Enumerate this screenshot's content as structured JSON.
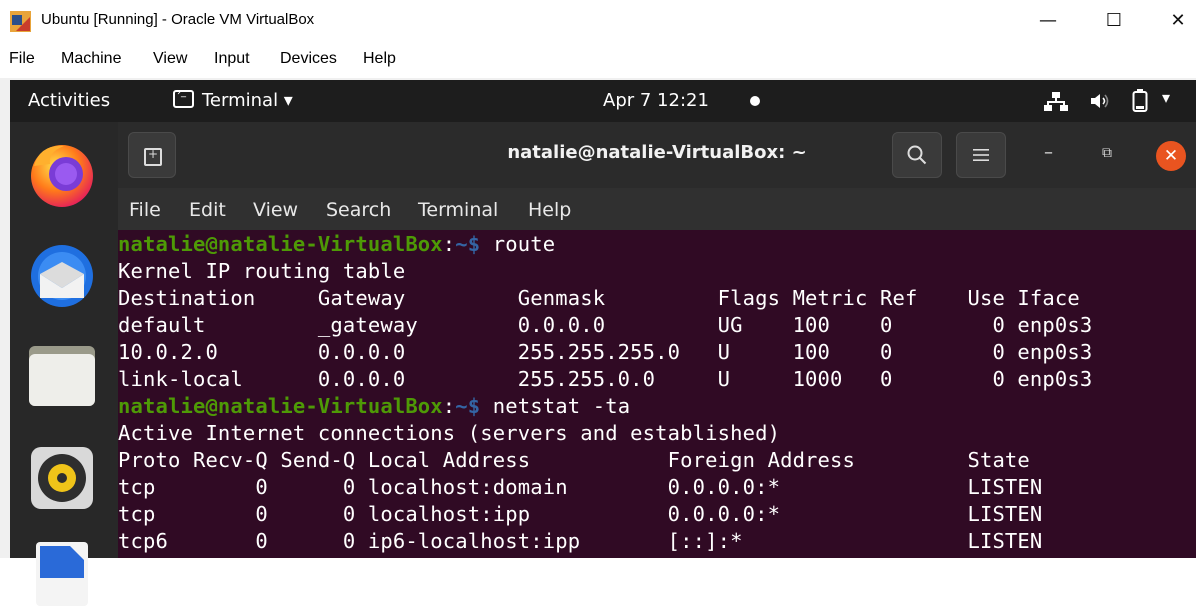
{
  "host": {
    "title": "Ubuntu [Running] - Oracle VM VirtualBox",
    "window_controls": {
      "minimize": "—",
      "maximize": "☐",
      "close": "✕"
    },
    "menu": [
      "File",
      "Machine",
      "View",
      "Input",
      "Devices",
      "Help"
    ]
  },
  "panel": {
    "activities": "Activities",
    "app_menu": "Terminal ▾",
    "clock": "Apr 7  12:21",
    "tray": {
      "network": "⛓",
      "volume": "🔈",
      "battery": "▯",
      "dropdown": "▾"
    }
  },
  "dock": [
    "firefox-icon",
    "thunderbird-icon",
    "files-icon",
    "rhythmbox-icon",
    "libreoffice-writer-icon"
  ],
  "terminal": {
    "title": "natalie@natalie-VirtualBox: ~",
    "search_icon": "⌕",
    "hamburger_icon": "≡",
    "minimize": "–",
    "restore": "⧉",
    "close": "✕",
    "menu": [
      "File",
      "Edit",
      "View",
      "Search",
      "Terminal",
      "Help"
    ],
    "prompt": {
      "user_host": "natalie@natalie-VirtualBox",
      "colon": ":",
      "path": "~$"
    },
    "lines": [
      {
        "type": "prompt",
        "cmd": " route"
      },
      {
        "type": "out",
        "text": "Kernel IP routing table"
      },
      {
        "type": "out",
        "text": "Destination     Gateway         Genmask         Flags Metric Ref    Use Iface"
      },
      {
        "type": "out",
        "text": "default         _gateway        0.0.0.0         UG    100    0        0 enp0s3"
      },
      {
        "type": "out",
        "text": "10.0.2.0        0.0.0.0         255.255.255.0   U     100    0        0 enp0s3"
      },
      {
        "type": "out",
        "text": "link-local      0.0.0.0         255.255.0.0     U     1000   0        0 enp0s3"
      },
      {
        "type": "prompt",
        "cmd": " netstat -ta"
      },
      {
        "type": "out",
        "text": "Active Internet connections (servers and established)"
      },
      {
        "type": "out",
        "text": "Proto Recv-Q Send-Q Local Address           Foreign Address         State"
      },
      {
        "type": "out",
        "text": "tcp        0      0 localhost:domain        0.0.0.0:*               LISTEN"
      },
      {
        "type": "out",
        "text": "tcp        0      0 localhost:ipp           0.0.0.0:*               LISTEN"
      },
      {
        "type": "out",
        "text": "tcp6       0      0 ip6-localhost:ipp       [::]:*                  LISTEN"
      }
    ]
  },
  "colors": {
    "terminal_bg": "#300a24",
    "prompt_user": "#4e9a06",
    "prompt_path": "#3465a4",
    "accent_close": "#e95420"
  }
}
